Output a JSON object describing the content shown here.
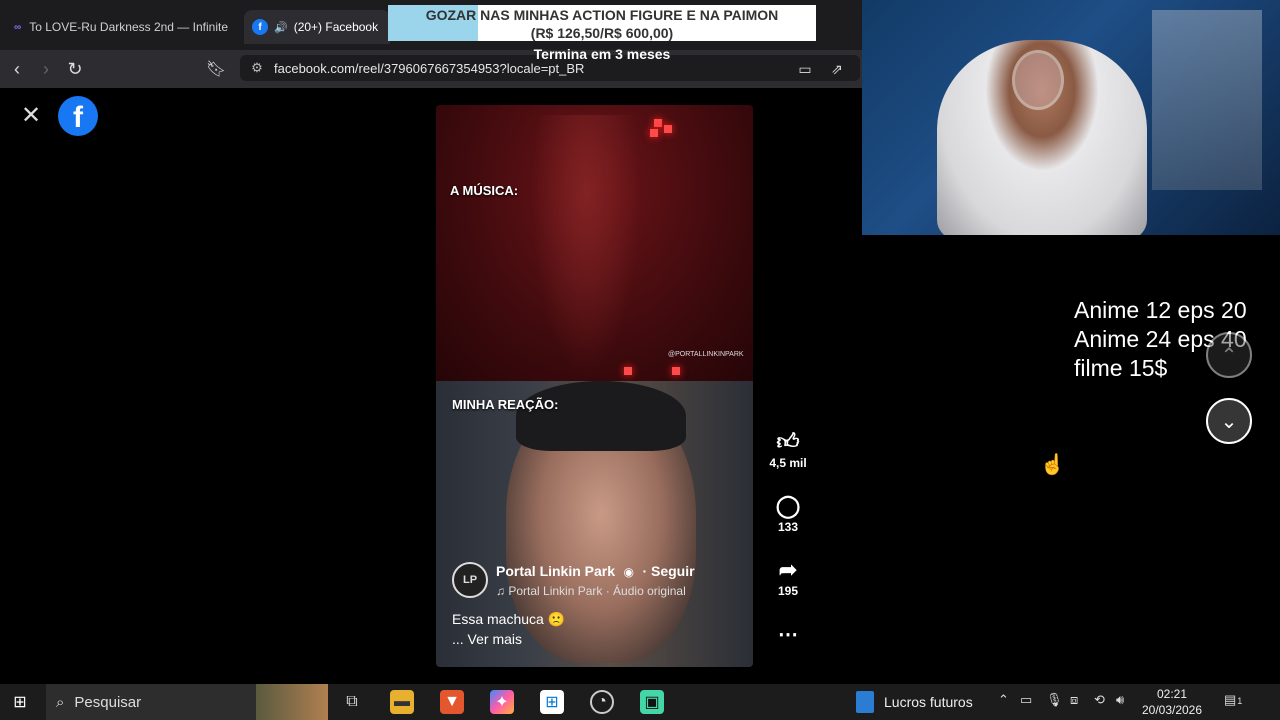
{
  "browser": {
    "tabs": [
      {
        "label": "To LOVE-Ru Darkness 2nd — Infinite",
        "icon": "infinite-icon",
        "active": false
      },
      {
        "label": "(20+) Facebook",
        "icon": "facebook-icon",
        "active": true
      }
    ],
    "url": "facebook.com/reel/3796067667354953?locale=pt_BR"
  },
  "overlay": {
    "banner_highlight": "GOZAR",
    "banner_line1": "NAS MINHAS ACTION FIGURE E NA PAIMON",
    "banner_line2": "(R$ 126,50/R$ 600,00)",
    "banner_sub": "Termina em 3 meses",
    "price_lines": [
      "Anime 12 eps 20",
      "Anime 24 eps 40",
      "filme 15$"
    ]
  },
  "reel": {
    "top_caption": "A MÚSICA:",
    "bottom_caption": "MINHA REAÇÃO:",
    "watermark": "@PORTALLINKINPARK",
    "author": "Portal Linkin Park",
    "follow": "· Seguir",
    "audio": "Portal Linkin Park · Áudio original",
    "avatar_text": "LP",
    "caption": "Essa machuca 🙁",
    "see_more": "... Ver mais",
    "likes": "4,5 mil",
    "comments": "133",
    "shares": "195"
  },
  "taskbar": {
    "search_placeholder": "Pesquisar",
    "widget_label": "Lucros futuros",
    "time": "02:21",
    "date": "20/03/2026",
    "notification_count": "1"
  },
  "colors": {
    "facebook_blue": "#1877f2",
    "banner_highlight": "#8fd0e9"
  }
}
